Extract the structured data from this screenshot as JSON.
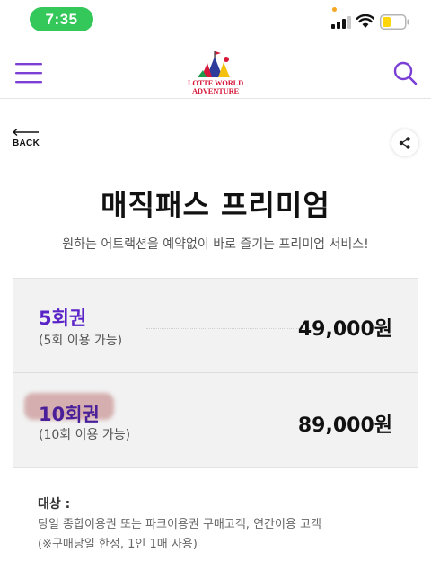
{
  "status_bar": {
    "time": "7:35",
    "icons": [
      "signal-icon",
      "wifi-icon",
      "battery-icon"
    ],
    "time_pill_color": "#34c759",
    "battery_fill_color": "#ffd60a"
  },
  "header": {
    "logo_line1": "LOTTE WORLD",
    "logo_line2": "ADVENTURE",
    "brand_color": "#d6193a",
    "accent_color": "#7b3fd6",
    "icons": [
      "menu-icon",
      "search-icon"
    ]
  },
  "back": {
    "label": "BACK"
  },
  "page": {
    "title": "매직패스 프리미엄",
    "subtitle": "원하는 어트랙션을 예약없이 바로 즐기는 프리미엄 서비스!"
  },
  "tickets": [
    {
      "name": "5회권",
      "desc": "(5회 이용 가능)",
      "price": "49,000원"
    },
    {
      "name": "10회권",
      "desc": "(10회 이용 가능)",
      "price": "89,000원"
    }
  ],
  "info": {
    "label": "대상 :",
    "line1": "당일 종합이용권 또는 파크이용권 구매고객, 연간이용 고객",
    "line2": "(※구매당일 한정, 1인 1매 사용)"
  }
}
